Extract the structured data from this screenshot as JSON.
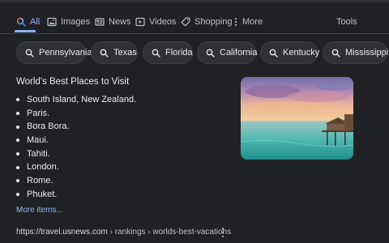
{
  "tabs": [
    {
      "label": "All",
      "icon": "search-icon",
      "active": true
    },
    {
      "label": "Images",
      "icon": "image-icon"
    },
    {
      "label": "News",
      "icon": "news-icon"
    },
    {
      "label": "Videos",
      "icon": "video-icon"
    },
    {
      "label": "Shopping",
      "icon": "tag-icon"
    },
    {
      "label": "More",
      "icon": "more-vert-icon"
    }
  ],
  "tools_label": "Tools",
  "chips": [
    "Pennsylvania",
    "Texas",
    "Florida",
    "California",
    "Kentucky",
    "Mississippi"
  ],
  "result": {
    "title": "World's Best Places to Visit",
    "items": [
      "South Island, New Zealand.",
      "Paris.",
      "Bora Bora.",
      "Maui.",
      "Tahiti.",
      "London.",
      "Rome.",
      "Phuket."
    ],
    "more_link": "More items...",
    "source_host": "https://travel.usnews.com",
    "source_path": " › rankings › worlds-best-vacations"
  },
  "colors": {
    "background": "#202124",
    "accent": "#8ab4f8",
    "chip": "#303134"
  }
}
